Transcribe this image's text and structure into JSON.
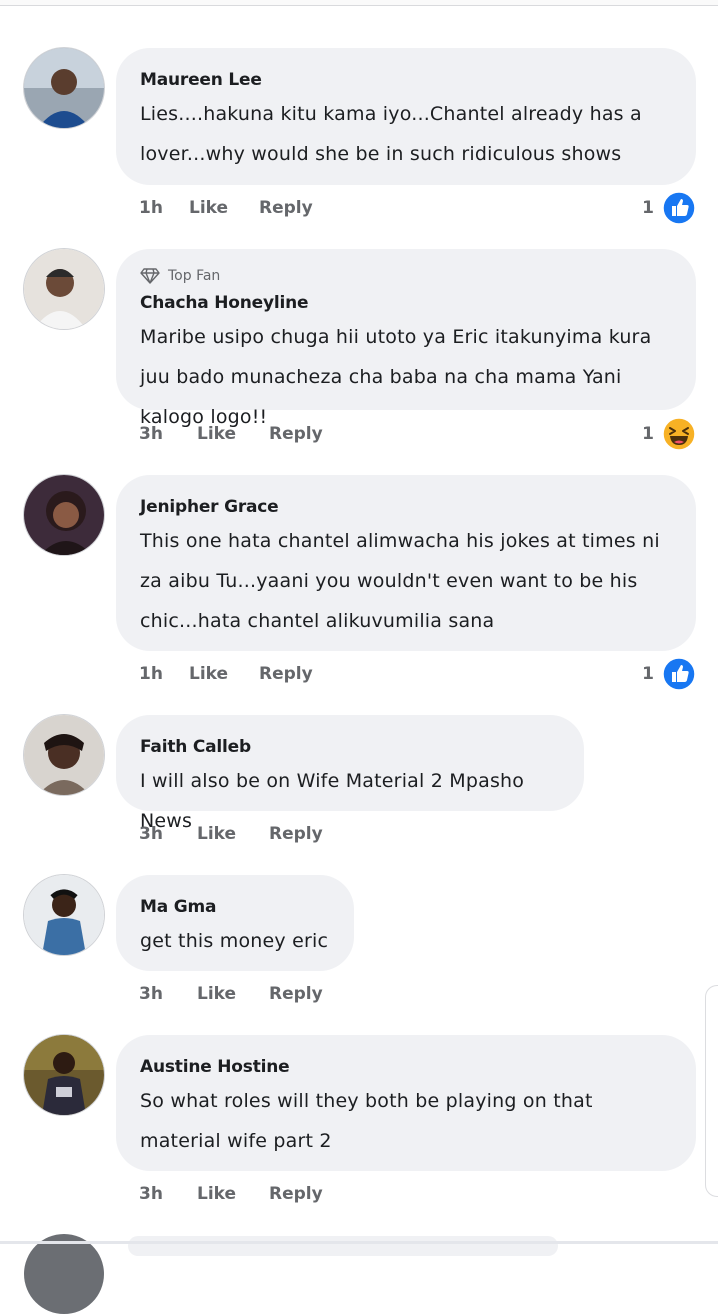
{
  "comments": [
    {
      "author": "Maureen Lee",
      "text": "Lies....hakuna kitu kama iyo...Chantel already has a lover...why would she be in such ridiculous shows",
      "time": "1h",
      "like_label": "Like",
      "reply_label": "Reply",
      "reaction_count": "1",
      "reaction": "like-icon"
    },
    {
      "badge": "Top Fan",
      "author": "Chacha Honeyline",
      "text": "Maribe usipo chuga hii utoto ya Eric itakunyima kura juu bado munacheza cha baba na cha mama Yani kalogo logo!!",
      "time": "3h",
      "like_label": "Like",
      "reply_label": "Reply",
      "reaction_count": "1",
      "reaction": "haha-icon"
    },
    {
      "author": "Jenipher Grace",
      "text": "This one hata chantel alimwacha his jokes at times ni za aibu Tu...yaani you wouldn't even want to be his chic...hata chantel alikuvumilia sana",
      "time": "1h",
      "like_label": "Like",
      "reply_label": "Reply",
      "reaction_count": "1",
      "reaction": "like-icon"
    },
    {
      "author": "Faith Calleb",
      "text": "I will also be on Wife Material 2 Mpasho News",
      "time": "3h",
      "like_label": "Like",
      "reply_label": "Reply"
    },
    {
      "author": "Ma Gma",
      "text": "get this money eric",
      "time": "3h",
      "like_label": "Like",
      "reply_label": "Reply"
    },
    {
      "author": "Austine Hostine",
      "text": "So what roles  will they both be playing on that material wife part 2",
      "time": "3h",
      "like_label": "Like",
      "reply_label": "Reply"
    }
  ],
  "colors": {
    "bubble": "#f0f1f4",
    "like_blue": "#1877f2",
    "haha_yellow": "#f7b125",
    "meta_gray": "#65676b"
  }
}
